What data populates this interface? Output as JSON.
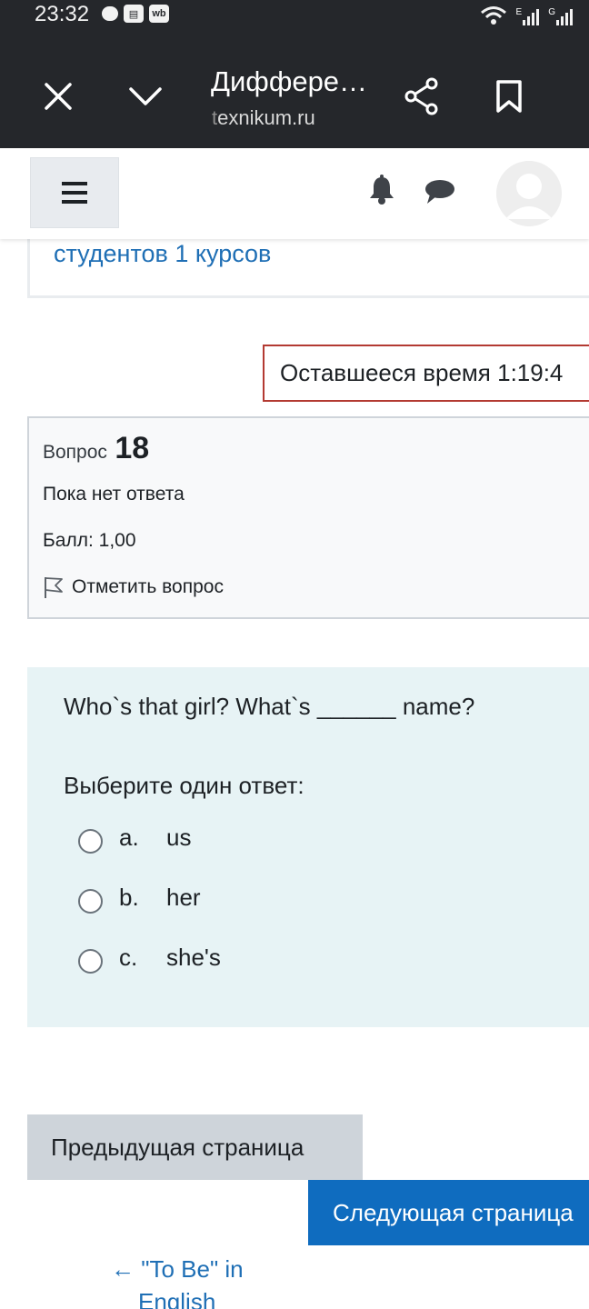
{
  "status_bar": {
    "time": "23:32",
    "app_icons": [
      "message-bubble-icon",
      "pdf-reader-icon",
      "wildberries-icon"
    ],
    "wb_label": "wb",
    "signal_labels": [
      "E",
      "G"
    ]
  },
  "browser": {
    "page_title": "Диффере…",
    "domain_dim": "t",
    "domain_rest": "exnikum.ru"
  },
  "course_link": "студентов 1 курсов",
  "timer": {
    "text": "Оставшееся время 1:19:4"
  },
  "question_info": {
    "label": "Вопрос",
    "number": "18",
    "state": "Пока нет ответа",
    "grade": "Балл: 1,00",
    "flag_label": "Отметить вопрос"
  },
  "question": {
    "text": "Who`s that girl? What`s ______ name?",
    "prompt": "Выберите один ответ:",
    "answers": [
      {
        "num": "a.",
        "text": "us",
        "selected": false
      },
      {
        "num": "b.",
        "text": "her",
        "selected": false
      },
      {
        "num": "c.",
        "text": "she's",
        "selected": false
      }
    ]
  },
  "nav": {
    "prev_label": "Предыдущая страница",
    "next_label": "Следующая страница",
    "prev_activity_line1": "← \"To Be\" in",
    "prev_activity_line2": "English"
  },
  "colors": {
    "toolbar_bg": "#25272b",
    "link": "#1f6fb5",
    "timer_border": "#b33a32",
    "question_bg": "#e7f3f5",
    "primary_button": "#0f6cbf",
    "secondary_button": "#ced4da"
  }
}
